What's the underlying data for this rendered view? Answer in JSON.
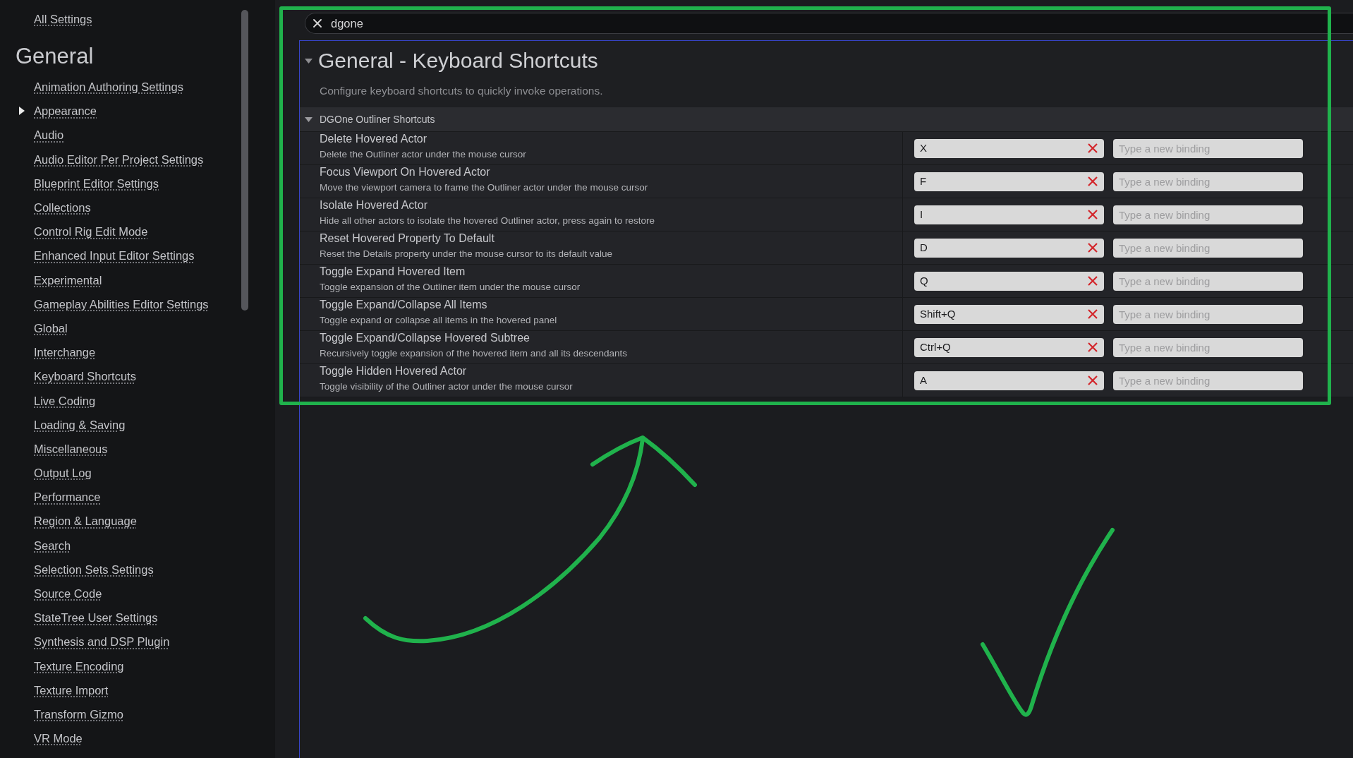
{
  "sidebar": {
    "all_settings_link": "All Settings",
    "section_title": "General",
    "items": [
      {
        "label": "Animation Authoring Settings",
        "kind": "page"
      },
      {
        "label": "Appearance",
        "kind": "group"
      },
      {
        "label": "Audio",
        "kind": "page"
      },
      {
        "label": "Audio Editor Per Project Settings",
        "kind": "page"
      },
      {
        "label": "Blueprint Editor Settings",
        "kind": "page"
      },
      {
        "label": "Collections",
        "kind": "page"
      },
      {
        "label": "Control Rig Edit Mode",
        "kind": "page"
      },
      {
        "label": "Enhanced Input Editor Settings",
        "kind": "page"
      },
      {
        "label": "Experimental",
        "kind": "page"
      },
      {
        "label": "Gameplay Abilities Editor Settings",
        "kind": "page"
      },
      {
        "label": "Global",
        "kind": "page"
      },
      {
        "label": "Interchange",
        "kind": "page"
      },
      {
        "label": "Keyboard Shortcuts",
        "kind": "page"
      },
      {
        "label": "Live Coding",
        "kind": "page"
      },
      {
        "label": "Loading & Saving",
        "kind": "page"
      },
      {
        "label": "Miscellaneous",
        "kind": "page"
      },
      {
        "label": "Output Log",
        "kind": "page"
      },
      {
        "label": "Performance",
        "kind": "page"
      },
      {
        "label": "Region & Language",
        "kind": "page"
      },
      {
        "label": "Search",
        "kind": "page"
      },
      {
        "label": "Selection Sets Settings",
        "kind": "page"
      },
      {
        "label": "Source Code",
        "kind": "page"
      },
      {
        "label": "StateTree User Settings",
        "kind": "page"
      },
      {
        "label": "Synthesis and DSP Plugin",
        "kind": "page"
      },
      {
        "label": "Texture Encoding",
        "kind": "page"
      },
      {
        "label": "Texture Import",
        "kind": "page"
      },
      {
        "label": "Transform Gizmo",
        "kind": "page"
      },
      {
        "label": "VR Mode",
        "kind": "page"
      }
    ]
  },
  "search": {
    "value": "dgone"
  },
  "section": {
    "title": "General - Keyboard Shortcuts",
    "expanded": true,
    "description": "Configure keyboard shortcuts to quickly invoke operations.",
    "category": {
      "title": "DGOne Outliner Shortcuts",
      "expanded": true,
      "shortcuts": [
        {
          "name": "Delete Hovered Actor",
          "description": "Delete the Outliner actor under the mouse cursor",
          "binding": "X",
          "new_binding": {
            "placeholder": "Type a new binding"
          }
        },
        {
          "name": "Focus Viewport On Hovered Actor",
          "description": "Move the viewport camera to frame the Outliner actor under the mouse cursor",
          "binding": "F",
          "new_binding": {
            "placeholder": "Type a new binding"
          }
        },
        {
          "name": "Isolate Hovered Actor",
          "description": "Hide all other actors to isolate the hovered Outliner actor, press again to restore",
          "binding": "I",
          "new_binding": {
            "placeholder": "Type a new binding"
          }
        },
        {
          "name": "Reset Hovered Property To Default",
          "description": "Reset the Details property under the mouse cursor to its default value",
          "binding": "D",
          "new_binding": {
            "placeholder": "Type a new binding"
          }
        },
        {
          "name": "Toggle Expand Hovered Item",
          "description": "Toggle expansion of the Outliner item under the mouse cursor",
          "binding": "Q",
          "new_binding": {
            "placeholder": "Type a new binding"
          }
        },
        {
          "name": "Toggle Expand/Collapse All Items",
          "description": "Toggle expand or collapse all items in the hovered panel",
          "binding": "Shift+Q",
          "new_binding": {
            "placeholder": "Type a new binding"
          }
        },
        {
          "name": "Toggle Expand/Collapse Hovered Subtree",
          "description": "Recursively toggle expansion of the hovered item and all its descendants",
          "binding": "Ctrl+Q",
          "new_binding": {
            "placeholder": "Type a new binding"
          }
        },
        {
          "name": "Toggle Hidden Hovered Actor",
          "description": "Toggle visibility of the Outliner actor under the mouse cursor",
          "binding": "A",
          "new_binding": {
            "placeholder": "Type a new binding"
          }
        }
      ]
    }
  }
}
